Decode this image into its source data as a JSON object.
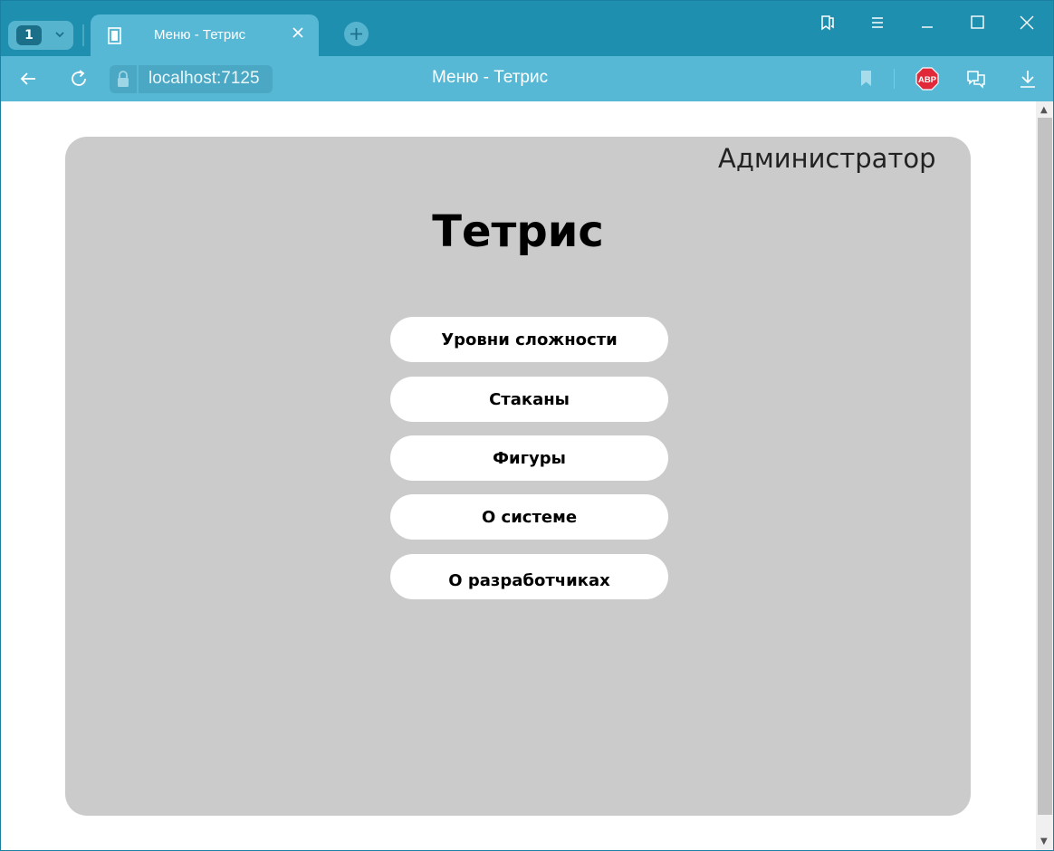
{
  "browser": {
    "tab_count": "1",
    "tab_title": "Меню - Тетрис",
    "url": "localhost:7125",
    "page_heading": "Меню - Тетрис",
    "adblock_label": "ABP",
    "colors": {
      "titlebar": "#1f8fb0",
      "addressbar": "#57b8d5",
      "adblock": "#e02a3a"
    }
  },
  "page": {
    "user_role": "Администратор",
    "title": "Тетрис",
    "menu": [
      {
        "label": "Уровни сложности"
      },
      {
        "label": "Стаканы"
      },
      {
        "label": "Фигуры"
      },
      {
        "label": "О системе"
      },
      {
        "label": "О разработчиках"
      }
    ],
    "colors": {
      "card": "#cbcbcb",
      "button": "#ffffff"
    }
  }
}
